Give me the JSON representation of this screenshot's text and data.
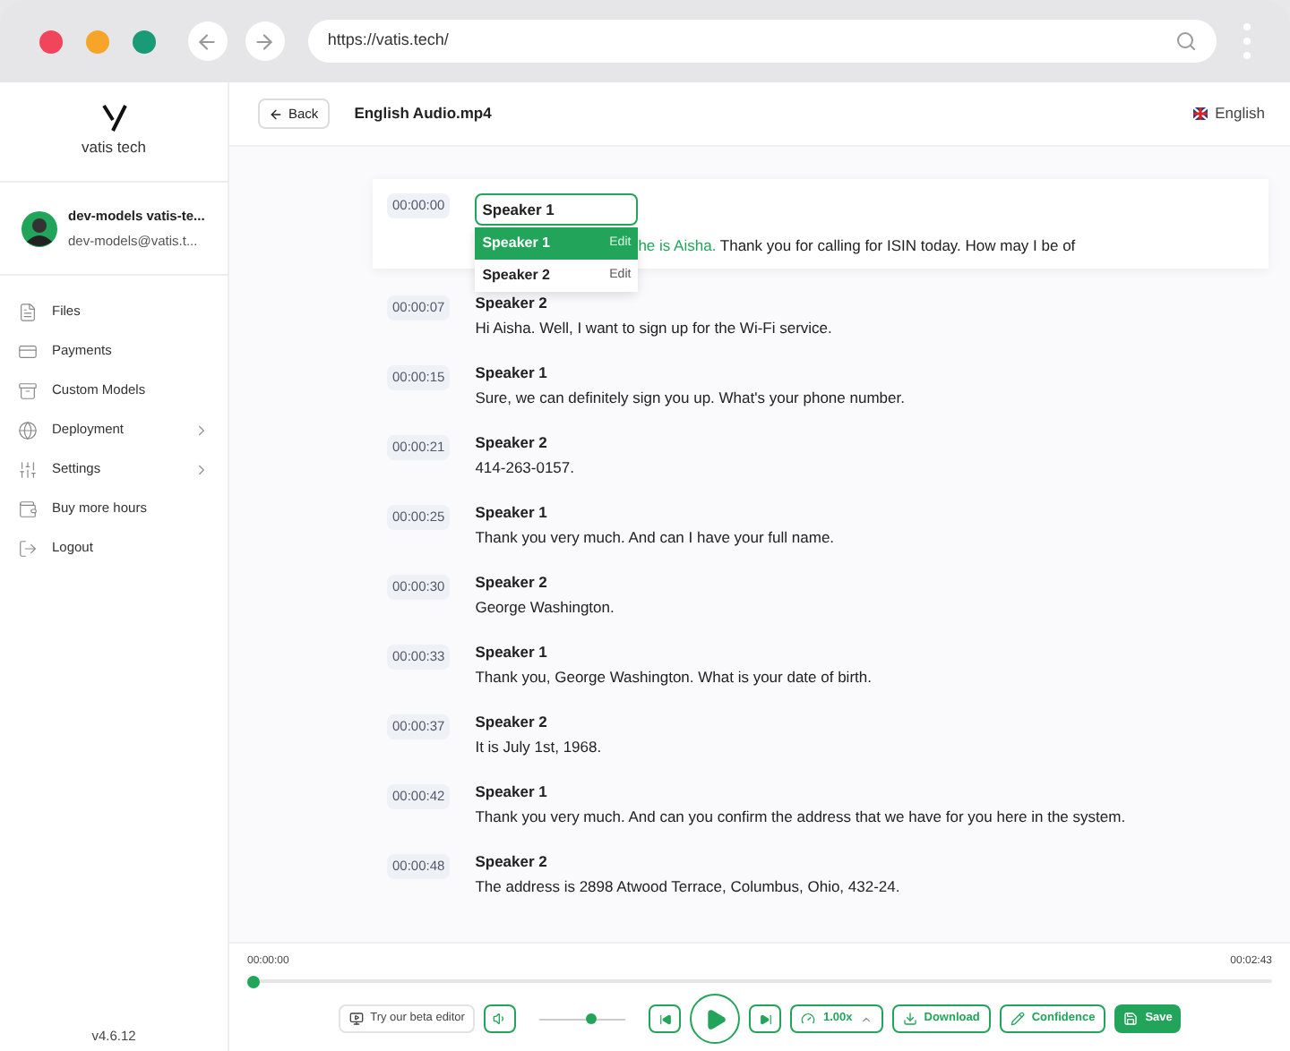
{
  "browser": {
    "url": "https://vatis.tech/"
  },
  "sidebar": {
    "logo": "vatis tech",
    "user": {
      "name": "dev-models vatis-te...",
      "email": "dev-models@vatis.t..."
    },
    "items": [
      {
        "label": "Files",
        "submenu": false
      },
      {
        "label": "Payments",
        "submenu": false
      },
      {
        "label": "Custom Models",
        "submenu": false
      },
      {
        "label": "Deployment",
        "submenu": true
      },
      {
        "label": "Settings",
        "submenu": true
      },
      {
        "label": "Buy more hours",
        "submenu": false
      },
      {
        "label": "Logout",
        "submenu": false
      }
    ],
    "version": "v4.6.12"
  },
  "header": {
    "back": "Back",
    "title": "English Audio.mp4",
    "language": "English"
  },
  "editing": {
    "time": "00:00:00",
    "speaker_value": "Speaker 1",
    "highlight": "he is Aisha.",
    "text": "Thank you for calling for ISIN today. How may I be of",
    "options": [
      {
        "label": "Speaker 1",
        "action": "Edit",
        "selected": true
      },
      {
        "label": "Speaker 2",
        "action": "Edit",
        "selected": false
      }
    ]
  },
  "segments": [
    {
      "time": "00:00:07",
      "speaker": "Speaker 2",
      "text": "Hi Aisha. Well, I want to sign up for the Wi-Fi service."
    },
    {
      "time": "00:00:15",
      "speaker": "Speaker 1",
      "text": "Sure, we can definitely sign you up. What's your phone number."
    },
    {
      "time": "00:00:21",
      "speaker": "Speaker 2",
      "text": "414-263-0157."
    },
    {
      "time": "00:00:25",
      "speaker": "Speaker 1",
      "text": "Thank you very much. And can I have your full name."
    },
    {
      "time": "00:00:30",
      "speaker": "Speaker 2",
      "text": "George Washington."
    },
    {
      "time": "00:00:33",
      "speaker": "Speaker 1",
      "text": "Thank you, George Washington. What is your date of birth."
    },
    {
      "time": "00:00:37",
      "speaker": "Speaker 2",
      "text": "It is July 1st, 1968."
    },
    {
      "time": "00:00:42",
      "speaker": "Speaker 1",
      "text": "Thank you very much. And can you confirm the address that we have for you here in the system."
    },
    {
      "time": "00:00:48",
      "speaker": "Speaker 2",
      "text": "The address is 2898 Atwood Terrace, Columbus, Ohio, 432-24."
    }
  ],
  "player": {
    "current": "00:00:00",
    "total": "00:02:43",
    "level": 0.0,
    "volume": {
      "level": 0.6
    },
    "beta": "Try our beta editor",
    "speed": "1.00x",
    "download": "Download",
    "confidence": "Confidence",
    "save": "Save"
  }
}
